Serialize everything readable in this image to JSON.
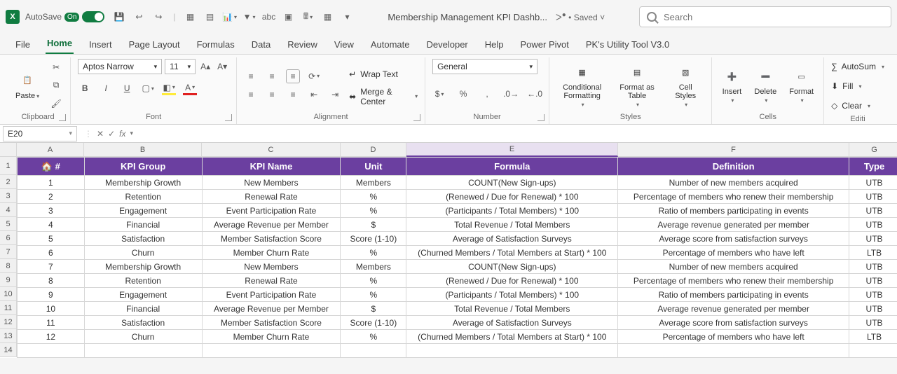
{
  "titlebar": {
    "autosave_label": "AutoSave",
    "autosave_state": "On",
    "doc_title": "Membership Management KPI Dashb...",
    "saved_status": "Saved",
    "search_placeholder": "Search"
  },
  "ribbon_tabs": [
    "File",
    "Home",
    "Insert",
    "Page Layout",
    "Formulas",
    "Data",
    "Review",
    "View",
    "Automate",
    "Developer",
    "Help",
    "Power Pivot",
    "PK's Utility Tool V3.0"
  ],
  "active_tab": "Home",
  "clipboard": {
    "paste": "Paste",
    "group": "Clipboard"
  },
  "font": {
    "name": "Aptos Narrow",
    "size": "11",
    "group": "Font"
  },
  "alignment": {
    "wrap": "Wrap Text",
    "merge": "Merge & Center",
    "group": "Alignment"
  },
  "number": {
    "format": "General",
    "group": "Number"
  },
  "styles": {
    "cond": "Conditional Formatting",
    "table": "Format as Table",
    "cell": "Cell Styles",
    "group": "Styles"
  },
  "cells": {
    "insert": "Insert",
    "delete": "Delete",
    "format": "Format",
    "group": "Cells"
  },
  "editing": {
    "sum": "AutoSum",
    "fill": "Fill",
    "clear": "Clear",
    "group": "Editi"
  },
  "namebox": "E20",
  "columns": [
    "A",
    "B",
    "C",
    "D",
    "E",
    "F",
    "G"
  ],
  "selected_column": "E",
  "header": {
    "num": "#",
    "group": "KPI Group",
    "name": "KPI Name",
    "unit": "Unit",
    "formula": "Formula",
    "definition": "Definition",
    "type": "Type"
  },
  "rows": [
    {
      "n": "1",
      "group": "Membership Growth",
      "name": "New Members",
      "unit": "Members",
      "formula": "COUNT(New Sign-ups)",
      "def": "Number of new members acquired",
      "type": "UTB"
    },
    {
      "n": "2",
      "group": "Retention",
      "name": "Renewal Rate",
      "unit": "%",
      "formula": "(Renewed / Due for Renewal) * 100",
      "def": "Percentage of members who renew their membership",
      "type": "UTB"
    },
    {
      "n": "3",
      "group": "Engagement",
      "name": "Event Participation Rate",
      "unit": "%",
      "formula": "(Participants / Total Members) * 100",
      "def": "Ratio of members participating in events",
      "type": "UTB"
    },
    {
      "n": "4",
      "group": "Financial",
      "name": "Average Revenue per Member",
      "unit": "$",
      "formula": "Total Revenue / Total Members",
      "def": "Average revenue generated per member",
      "type": "UTB"
    },
    {
      "n": "5",
      "group": "Satisfaction",
      "name": "Member Satisfaction Score",
      "unit": "Score (1-10)",
      "formula": "Average of Satisfaction Surveys",
      "def": "Average score from satisfaction surveys",
      "type": "UTB"
    },
    {
      "n": "6",
      "group": "Churn",
      "name": "Member Churn Rate",
      "unit": "%",
      "formula": "(Churned Members / Total Members at Start) * 100",
      "def": "Percentage of members who have left",
      "type": "LTB"
    },
    {
      "n": "7",
      "group": "Membership Growth",
      "name": "New Members",
      "unit": "Members",
      "formula": "COUNT(New Sign-ups)",
      "def": "Number of new members acquired",
      "type": "UTB"
    },
    {
      "n": "8",
      "group": "Retention",
      "name": "Renewal Rate",
      "unit": "%",
      "formula": "(Renewed / Due for Renewal) * 100",
      "def": "Percentage of members who renew their membership",
      "type": "UTB"
    },
    {
      "n": "9",
      "group": "Engagement",
      "name": "Event Participation Rate",
      "unit": "%",
      "formula": "(Participants / Total Members) * 100",
      "def": "Ratio of members participating in events",
      "type": "UTB"
    },
    {
      "n": "10",
      "group": "Financial",
      "name": "Average Revenue per Member",
      "unit": "$",
      "formula": "Total Revenue / Total Members",
      "def": "Average revenue generated per member",
      "type": "UTB"
    },
    {
      "n": "11",
      "group": "Satisfaction",
      "name": "Member Satisfaction Score",
      "unit": "Score (1-10)",
      "formula": "Average of Satisfaction Surveys",
      "def": "Average score from satisfaction surveys",
      "type": "UTB"
    },
    {
      "n": "12",
      "group": "Churn",
      "name": "Member Churn Rate",
      "unit": "%",
      "formula": "(Churned Members / Total Members at Start) * 100",
      "def": "Percentage of members who have left",
      "type": "LTB"
    }
  ],
  "row_numbers": [
    "1",
    "2",
    "3",
    "4",
    "5",
    "6",
    "7",
    "8",
    "9",
    "10",
    "11",
    "12",
    "13",
    "14"
  ]
}
